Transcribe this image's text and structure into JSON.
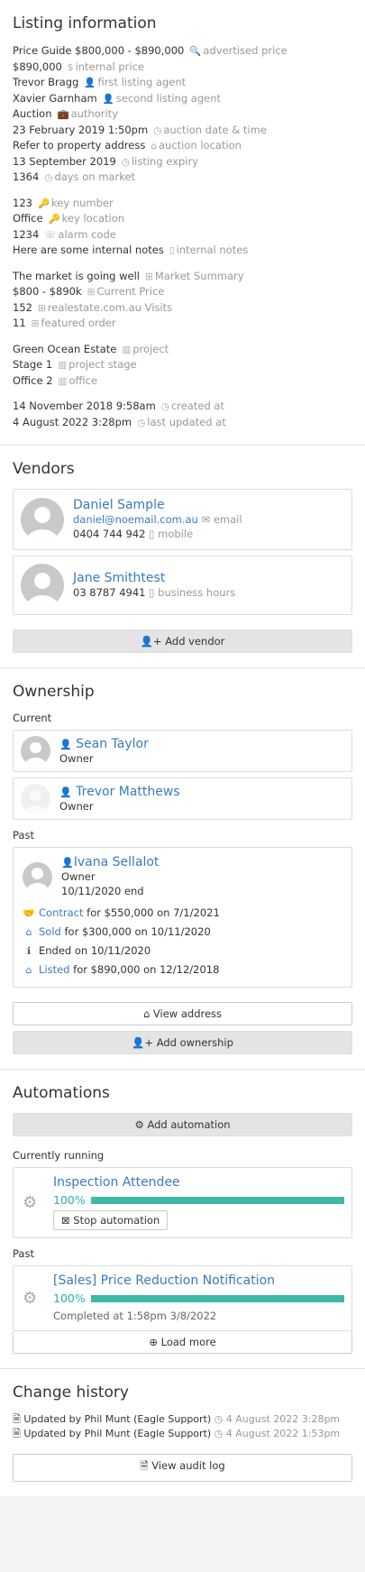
{
  "listing": {
    "title": "Listing information",
    "groups": [
      [
        {
          "value": "Price Guide $800,000 - $890,000",
          "icon": "search-icon",
          "glyph": "🔍",
          "label": "advertised price"
        },
        {
          "value": "$890,000",
          "icon": "dollar-icon",
          "glyph": "$",
          "label": "internal price"
        },
        {
          "value": "Trevor Bragg",
          "icon": "user-icon",
          "glyph": "👤",
          "label": "first listing agent"
        },
        {
          "value": "Xavier Garnham",
          "icon": "user-icon",
          "glyph": "👤",
          "label": "second listing agent"
        },
        {
          "value": "Auction",
          "icon": "briefcase-icon",
          "glyph": "💼",
          "label": "authority"
        },
        {
          "value": "23 February 2019 1:50pm",
          "icon": "clock-icon",
          "glyph": "◷",
          "label": "auction date & time"
        },
        {
          "value": "Refer to property address",
          "icon": "home-icon",
          "glyph": "⌂",
          "label": "auction location"
        },
        {
          "value": "13 September 2019",
          "icon": "clock-icon",
          "glyph": "◷",
          "label": "listing expiry"
        },
        {
          "value": "1364",
          "icon": "clock-icon",
          "glyph": "◷",
          "label": "days on market"
        }
      ],
      [
        {
          "value": "123",
          "icon": "key-icon",
          "glyph": "🔑",
          "label": "key number"
        },
        {
          "value": "Office",
          "icon": "key-icon",
          "glyph": "🔑",
          "label": "key location"
        },
        {
          "value": "1234",
          "icon": "alarm-icon",
          "glyph": "☏",
          "label": "alarm code"
        },
        {
          "value": "Here are some internal notes",
          "icon": "notes-icon",
          "glyph": "▯",
          "label": "internal notes"
        }
      ],
      [
        {
          "value": "The market is going well",
          "icon": "plus-square-icon",
          "glyph": "⊞",
          "label": "Market Summary"
        },
        {
          "value": "$800 - $890k",
          "icon": "plus-square-icon",
          "glyph": "⊞",
          "label": "Current Price"
        },
        {
          "value": "152",
          "icon": "plus-square-icon",
          "glyph": "⊞",
          "label": "realestate.com.au Visits"
        },
        {
          "value": "11",
          "icon": "plus-square-icon",
          "glyph": "⊞",
          "label": "featured order"
        }
      ],
      [
        {
          "value": "Green Ocean Estate",
          "icon": "building-icon",
          "glyph": "▥",
          "label": "project"
        },
        {
          "value": "Stage 1",
          "icon": "building-icon",
          "glyph": "▥",
          "label": "project stage"
        },
        {
          "value": "Office 2",
          "icon": "building-icon",
          "glyph": "▥",
          "label": "office"
        }
      ],
      [
        {
          "value": "14 November 2018 9:58am",
          "icon": "clock-icon",
          "glyph": "◷",
          "label": "created at"
        },
        {
          "value": "4 August 2022 3:28pm",
          "icon": "clock-icon",
          "glyph": "◷",
          "label": "last updated at"
        }
      ]
    ]
  },
  "vendors": {
    "title": "Vendors",
    "items": [
      {
        "name": "Daniel Sample",
        "email": "daniel@noemail.com.au",
        "email_label": "email",
        "phone": "0404 744 942",
        "phone_label": "mobile"
      },
      {
        "name": "Jane Smithtest",
        "phone": "03 8787 4941",
        "phone_label": "business hours"
      }
    ],
    "add_label": "Add vendor"
  },
  "ownership": {
    "title": "Ownership",
    "current_label": "Current",
    "current": [
      {
        "name": "Sean Taylor",
        "role": "Owner"
      },
      {
        "name": "Trevor Matthews",
        "role": "Owner"
      }
    ],
    "past_label": "Past",
    "past": {
      "name": "Ivana Sellalot",
      "role": "Owner",
      "end": "10/11/2020 end",
      "events": [
        {
          "icon": "handshake-icon",
          "glyph": "🤝",
          "link": "Contract",
          "rest": " for $550,000 on 7/1/2021"
        },
        {
          "icon": "home-icon",
          "glyph": "⌂",
          "link": "Sold",
          "rest": " for $300,000 on 10/11/2020"
        },
        {
          "icon": "info-icon",
          "glyph": "ℹ",
          "link": "",
          "rest": "Ended on 10/11/2020"
        },
        {
          "icon": "home-icon",
          "glyph": "⌂",
          "link": "Listed",
          "rest": " for $890,000 on 12/12/2018"
        }
      ]
    },
    "view_address_label": "View address",
    "add_label": "Add ownership"
  },
  "automations": {
    "title": "Automations",
    "add_label": "Add automation",
    "running_label": "Currently running",
    "running": {
      "name": "Inspection Attendee",
      "percent": "100%",
      "progress": 1.0,
      "stop_label": "Stop automation"
    },
    "past_label": "Past",
    "past": {
      "name": "[Sales] Price Reduction Notification",
      "percent": "100%",
      "progress": 1.0,
      "completed": "Completed at 1:58pm 3/8/2022"
    },
    "load_more_label": "Load more"
  },
  "history": {
    "title": "Change history",
    "items": [
      {
        "text": "Updated by Phil Munt (Eagle Support)",
        "time": "4 August 2022 3:28pm"
      },
      {
        "text": "Updated by Phil Munt (Eagle Support)",
        "time": "4 August 2022 1:53pm"
      }
    ],
    "audit_label": "View audit log"
  },
  "colors": {
    "accent": "#3a7bbf",
    "progress": "#3fb8a5",
    "muted": "#999999"
  }
}
